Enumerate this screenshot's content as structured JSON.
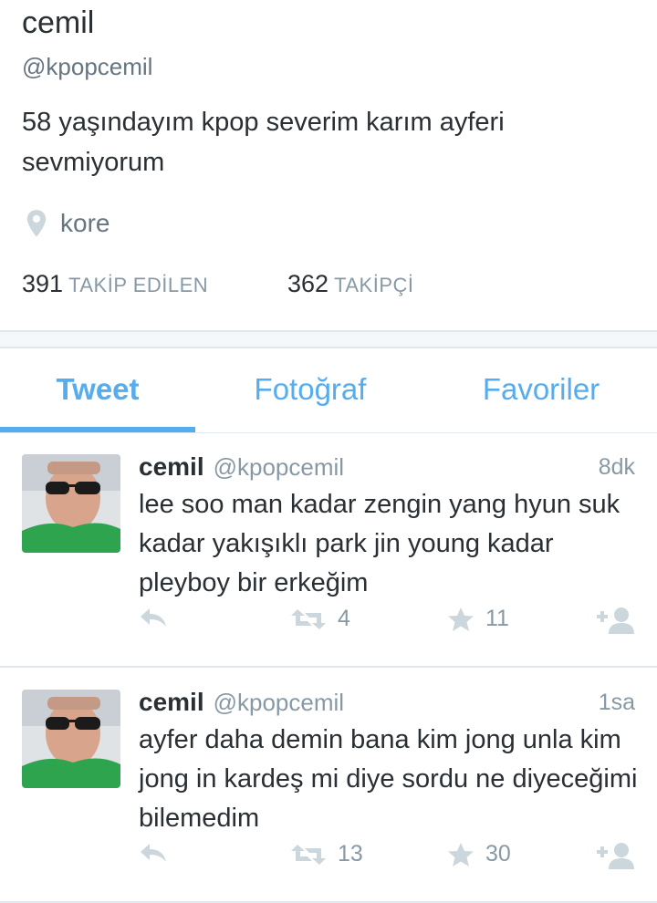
{
  "profile": {
    "name": "cemil",
    "handle": "@kpopcemil",
    "bio": "58 yaşındayım kpop severim karım ayferi sevmiyorum",
    "location": "kore",
    "following_count": "391",
    "following_label": "TAKİP EDİLEN",
    "followers_count": "362",
    "followers_label": "TAKİPÇİ"
  },
  "tabs": [
    {
      "label": "Tweet",
      "active": true
    },
    {
      "label": "Fotoğraf",
      "active": false
    },
    {
      "label": "Favoriler",
      "active": false
    }
  ],
  "tweets": [
    {
      "name": "cemil",
      "handle": "@kpopcemil",
      "time": "8dk",
      "text": "lee soo man kadar zengin yang hyun suk kadar yakışıklı park jin young kadar pleyboy bir erkeğim",
      "retweets": "4",
      "favorites": "11"
    },
    {
      "name": "cemil",
      "handle": "@kpopcemil",
      "time": "1sa",
      "text": "ayfer daha demin bana kim jong unla kim jong in kardeş mi diye sordu ne diyeceğimi bilemedim",
      "retweets": "13",
      "favorites": "30"
    }
  ],
  "icons": {
    "location": "location-pin-icon",
    "reply": "reply-icon",
    "retweet": "retweet-icon",
    "favorite": "star-icon",
    "follow": "follow-user-icon"
  },
  "colors": {
    "accent": "#55acee",
    "text": "#292f33",
    "muted": "#8899a6",
    "divider": "#e1e8ed"
  }
}
